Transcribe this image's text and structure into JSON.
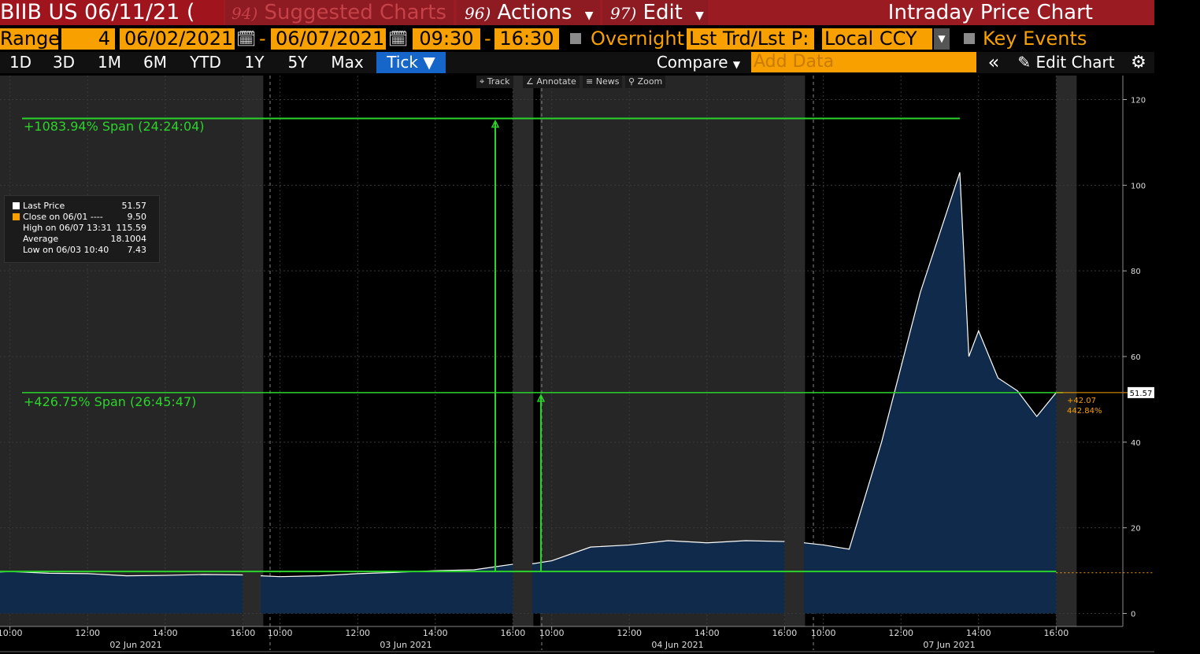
{
  "titlebar": {
    "ticker": "BIIB US 06/11/21 (",
    "suggested_num": "94)",
    "suggested_label": "Suggested Charts",
    "actions_num": "96)",
    "actions_label": "Actions",
    "edit_num": "97)",
    "edit_label": "Edit",
    "title": "Intraday Price Chart"
  },
  "range": {
    "label": "Range",
    "count": "4",
    "start_date": "06/02/2021",
    "dash": "-",
    "end_date": "06/07/2021",
    "start_time": "09:30",
    "time_dash": "-",
    "end_time": "16:30",
    "overnight": "Overnight",
    "mode": "Lst Trd/Lst P:",
    "currency": "Local CCY",
    "key_events": "Key Events"
  },
  "periods": [
    "1D",
    "3D",
    "1M",
    "6M",
    "YTD",
    "1Y",
    "5Y",
    "Max",
    "Tick ▼"
  ],
  "active_period": "Tick ▼",
  "toolbar": {
    "compare": "Compare",
    "add_data_placeholder": "Add Data",
    "collapse": "«",
    "edit_chart": "Edit Chart"
  },
  "chart_tools": [
    "Track",
    "Annotate",
    "News",
    "Zoom"
  ],
  "legend": [
    {
      "label": "Last Price",
      "value": "51.57"
    },
    {
      "label": "Close on 06/01 ----",
      "value": "9.50"
    },
    {
      "label": "High on 06/07 13:31",
      "value": "115.59"
    },
    {
      "label": "Average",
      "value": "18.1004"
    },
    {
      "label": "Low on 06/03 10:40",
      "value": "7.43"
    }
  ],
  "annotations": {
    "span1": "+1083.94% Span (24:24:04)",
    "span2": "+426.75% Span (26:45:47)",
    "last_price_tag": "51.57",
    "change_abs": "+42.07",
    "change_pct": "442.84%"
  },
  "colors": {
    "accent_orange": "#f7a000",
    "titlebar_red": "#9b1b23",
    "span_green": "#2bd42b",
    "area_fill": "#0f2a4a",
    "price_line": "#ffffff"
  },
  "chart_data": {
    "type": "area",
    "title": "",
    "ylim": [
      0,
      120
    ],
    "y_ticks": [
      0,
      20,
      40,
      60,
      80,
      100,
      120
    ],
    "x_tick_labels": [
      "10:00",
      "12:00",
      "14:00",
      "16:00",
      "10:00",
      "12:00",
      "14:00",
      "16:00",
      "10:00",
      "12:00",
      "14:00",
      "16:00",
      "10:00",
      "12:00",
      "14:00",
      "16:00"
    ],
    "day_labels": [
      "02 Jun 2021",
      "03 Jun 2021",
      "04 Jun 2021",
      "07 Jun 2021"
    ],
    "days": [
      {
        "date": "2021-06-02",
        "times": [
          "09:30",
          "10:00",
          "11:00",
          "12:00",
          "13:00",
          "14:00",
          "15:00",
          "16:00"
        ],
        "values": [
          9.6,
          9.8,
          9.4,
          9.3,
          8.8,
          8.9,
          9.1,
          9.0
        ]
      },
      {
        "date": "2021-06-03",
        "times": [
          "09:30",
          "10:00",
          "11:00",
          "12:00",
          "13:00",
          "14:00",
          "15:00",
          "16:00"
        ],
        "values": [
          8.8,
          8.6,
          8.8,
          9.3,
          9.6,
          10.0,
          10.2,
          11.5
        ]
      },
      {
        "date": "2021-06-04",
        "times": [
          "09:30",
          "10:00",
          "11:00",
          "12:00",
          "13:00",
          "14:00",
          "15:00",
          "16:00"
        ],
        "values": [
          11.6,
          12.3,
          15.5,
          16.0,
          17.0,
          16.5,
          17.0,
          16.8
        ]
      },
      {
        "date": "2021-06-07",
        "times": [
          "09:30",
          "10:00",
          "10:40",
          "11:30",
          "12:30",
          "13:31",
          "13:45",
          "14:00",
          "14:30",
          "15:00",
          "15:30",
          "16:00"
        ],
        "values": [
          16.5,
          16.0,
          15.0,
          40.0,
          75.0,
          103.0,
          60.0,
          66.0,
          55.0,
          52.0,
          46.0,
          51.57
        ]
      }
    ],
    "reference_lines": [
      {
        "name": "Close on 06/01",
        "value": 9.5,
        "style": "dotted",
        "color": "#f7a000"
      },
      {
        "name": "Span line low",
        "value": 9.8,
        "color": "#2bd42b"
      },
      {
        "name": "Span line mid",
        "value": 51.57,
        "color": "#2bd42b"
      },
      {
        "name": "Span line high",
        "value": 115.59,
        "color": "#2bd42b"
      }
    ],
    "last_price": 51.57,
    "grid": true
  }
}
